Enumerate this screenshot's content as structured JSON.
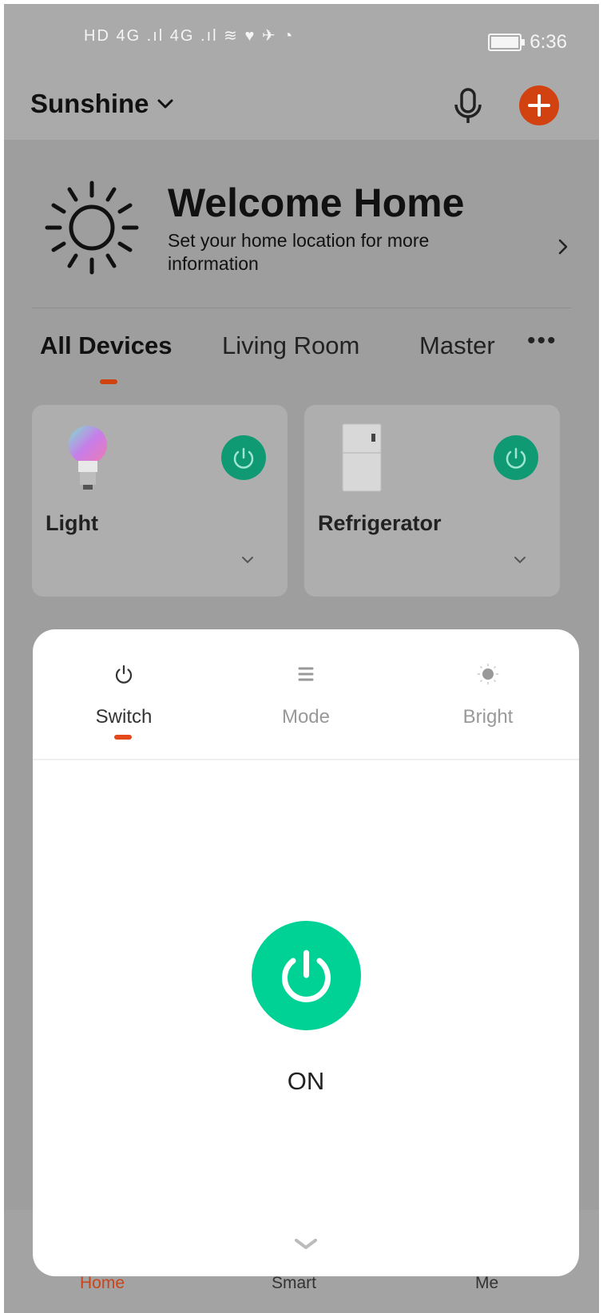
{
  "status_bar": {
    "left_icons": "HD 4G .ıl 4G .ıl ≋ ♥ ✈ ◔",
    "time": "6:36"
  },
  "header": {
    "home_name": "Sunshine",
    "icons": [
      "chevron-down-icon",
      "microphone-icon",
      "add-icon"
    ]
  },
  "welcome": {
    "title": "Welcome Home",
    "subtitle": "Set your home location for more information"
  },
  "room_tabs": {
    "items": [
      "All Devices",
      "Living Room",
      "Master"
    ],
    "active": "All Devices"
  },
  "devices": [
    {
      "name": "Light",
      "icon": "light-bulb-icon",
      "power": "on"
    },
    {
      "name": "Refrigerator",
      "icon": "refrigerator-icon",
      "power": "on"
    }
  ],
  "control_sheet": {
    "tabs": [
      {
        "label": "Switch",
        "icon": "power-icon",
        "active": true
      },
      {
        "label": "Mode",
        "icon": "list-icon",
        "active": false
      },
      {
        "label": "Bright",
        "icon": "brightness-icon",
        "active": false
      }
    ],
    "state": "ON"
  },
  "bottom_nav": {
    "items": [
      "Home",
      "Smart",
      "Me"
    ],
    "active": "Home"
  },
  "colors": {
    "accent": "#d14210",
    "power_green": "#00d296",
    "overlay_gray": "#9e9e9e"
  }
}
